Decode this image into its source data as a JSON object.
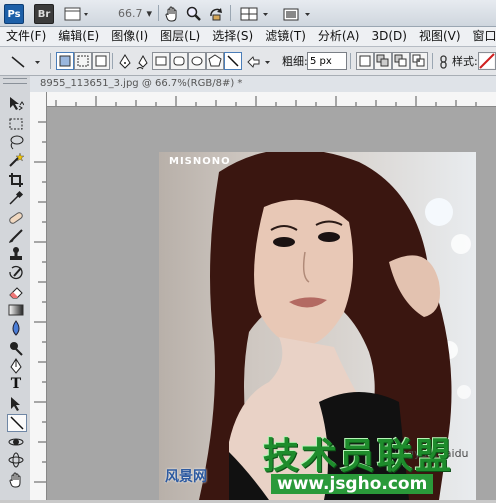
{
  "app": {
    "logo": "Ps",
    "bridge_logo": "Br",
    "zoom_display": "66.7"
  },
  "menubar": {
    "items": [
      "文件(F)",
      "编辑(E)",
      "图像(I)",
      "图层(L)",
      "选择(S)",
      "滤镜(T)",
      "分析(A)",
      "3D(D)",
      "视图(V)",
      "窗口(W)"
    ]
  },
  "options": {
    "weight_label": "粗细:",
    "weight_value": "5 px",
    "style_label": "样式:"
  },
  "document": {
    "tab_title": "8955_113651_3.jpg @ 66.7%(RGB/8#) *"
  },
  "photo": {
    "brand_text": "MISNONO",
    "watermark_main": "技术员联盟",
    "watermark_url": "www.jsgho.com",
    "watermark_small": "jingyan.baidu",
    "watermark_left": "风景网"
  },
  "colors": {
    "ps_blue": "#1c5fa8",
    "watermark_green": "#1e8c2c",
    "canvas_gray": "#a6a6a6"
  },
  "icons": [
    "hand-icon",
    "zoom-icon",
    "rotate-view-icon",
    "arrange-icon",
    "screen-mode-icon",
    "line-tool-icon",
    "move-icon",
    "marquee-icon",
    "lasso-icon",
    "magic-wand-icon",
    "crop-icon",
    "eyedropper-icon",
    "healing-icon",
    "brush-icon",
    "stamp-icon",
    "history-brush-icon",
    "eraser-icon",
    "gradient-icon",
    "blur-icon",
    "dodge-icon",
    "pen-icon",
    "type-icon",
    "path-select-icon",
    "line-icon",
    "3d-rotate-icon",
    "3d-orbit-icon",
    "hand-tool-icon"
  ]
}
